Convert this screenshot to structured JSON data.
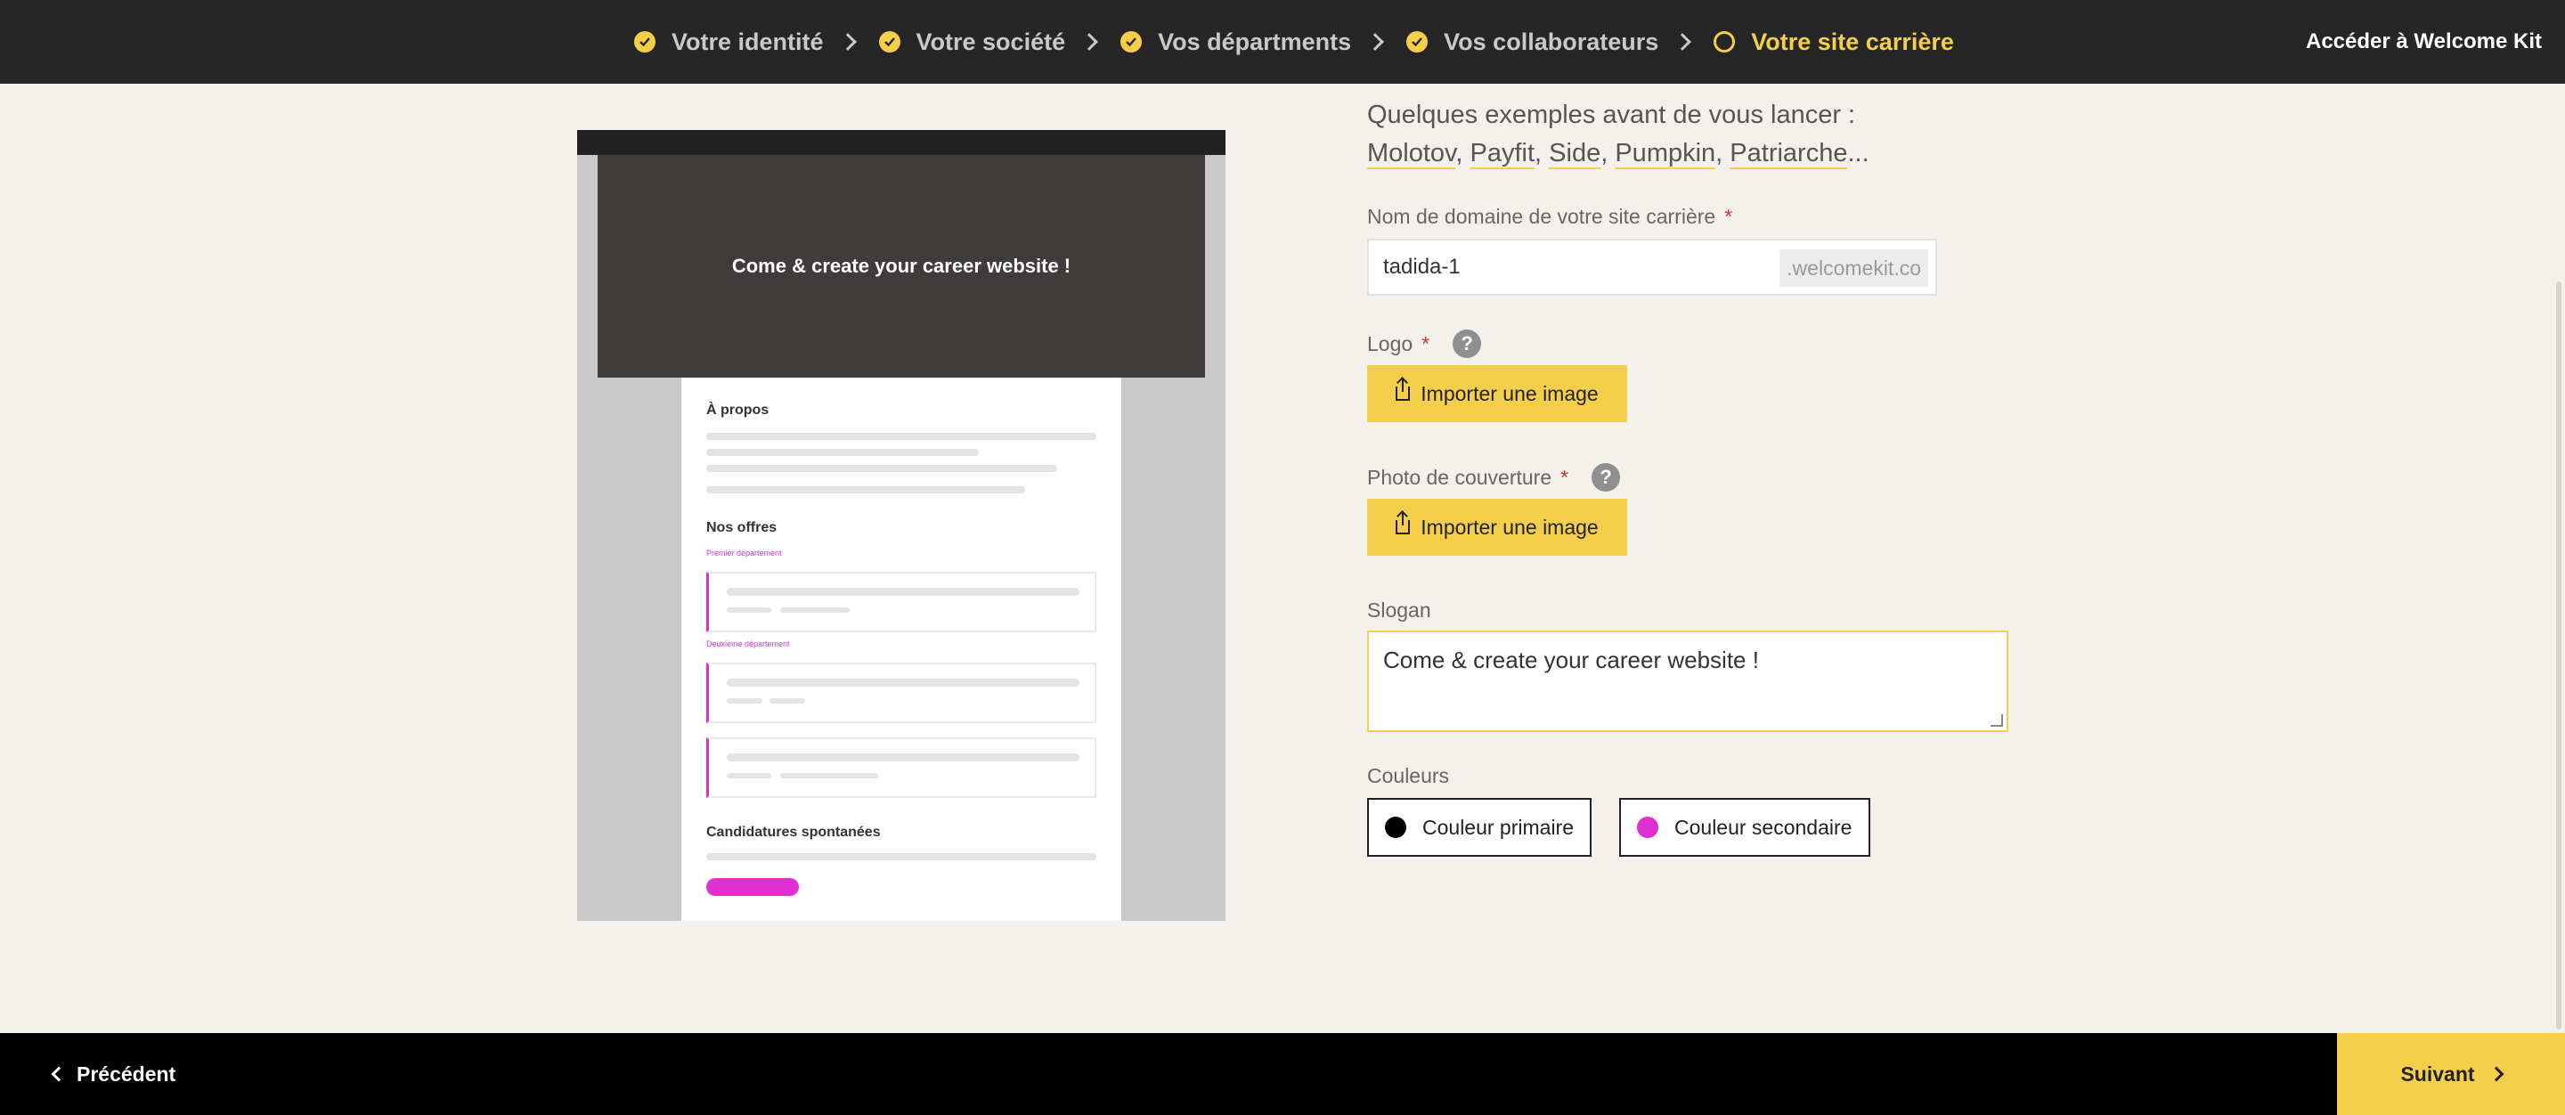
{
  "nav": {
    "steps": [
      {
        "label": "Votre identité",
        "done": true
      },
      {
        "label": "Votre société",
        "done": true
      },
      {
        "label": "Vos départments",
        "done": true
      },
      {
        "label": "Vos collaborateurs",
        "done": true
      },
      {
        "label": "Votre site carrière",
        "done": false
      }
    ],
    "kit_link": "Accéder à Welcome Kit"
  },
  "preview": {
    "hero_text": "Come & create your career website !",
    "about_title": "À propos",
    "offers_title": "Nos offres",
    "dept1": "Premier département",
    "dept2": "Deuxième département",
    "spontaneous_title": "Candidatures spontanées"
  },
  "form": {
    "examples_intro": "Quelques exemples avant de vous lancer :",
    "examples": [
      "Molotov",
      "Payfit",
      "Side",
      "Pumpkin",
      "Patriarche"
    ],
    "examples_suffix": "...",
    "domain_label": "Nom de domaine de votre site carrière",
    "domain_value": "tadida-1",
    "domain_suffix": ".welcomekit.co",
    "logo_label": "Logo",
    "cover_label": "Photo de couverture",
    "upload_label": "Importer une image",
    "slogan_label": "Slogan",
    "slogan_value": "Come & create your career website !",
    "colors_label": "Couleurs",
    "primary_color_label": "Couleur primaire",
    "secondary_color_label": "Couleur secondaire",
    "primary_color": "#000000",
    "secondary_color": "#e02fd0",
    "required_mark": "*",
    "help_mark": "?"
  },
  "footer": {
    "prev_label": "Précédent",
    "next_label": "Suivant"
  }
}
